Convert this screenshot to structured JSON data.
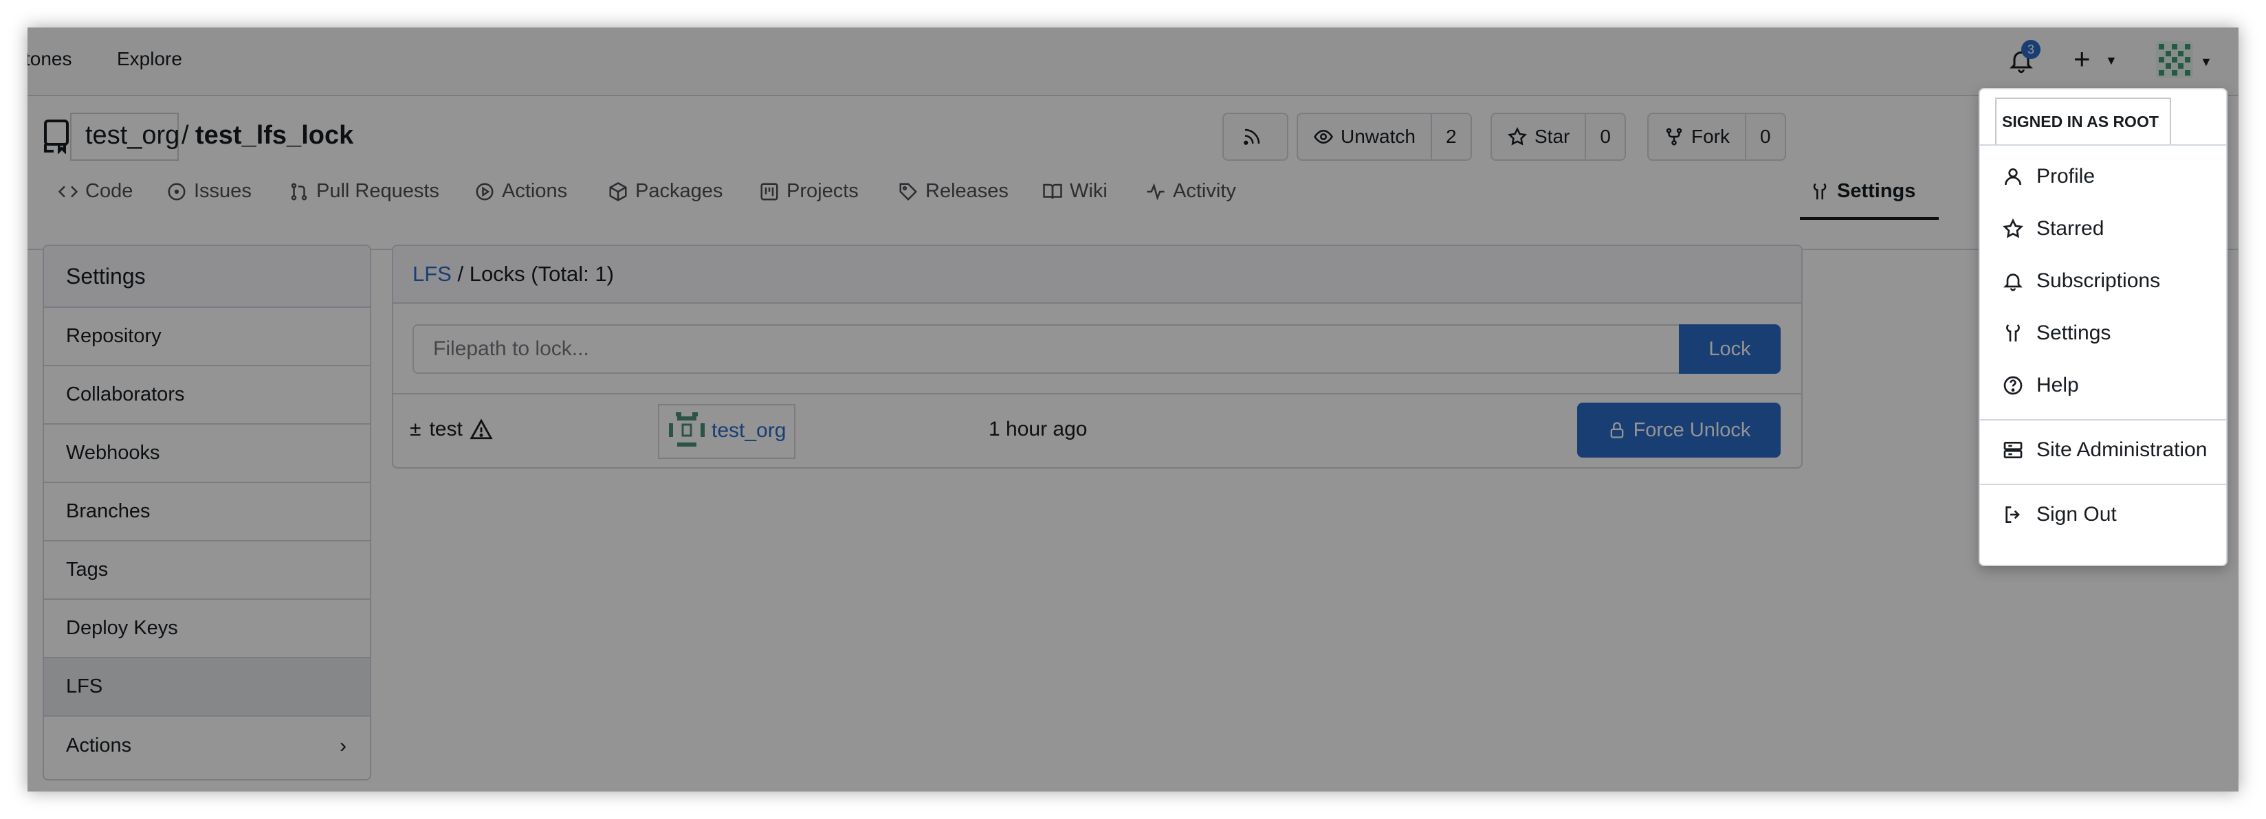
{
  "topnav": {
    "links": [
      "tones",
      "Explore"
    ],
    "notification_count": "3"
  },
  "repo": {
    "owner": "test_org",
    "separator": "/",
    "name": "test_lfs_lock",
    "watch": {
      "label": "Unwatch",
      "count": "2"
    },
    "star": {
      "label": "Star",
      "count": "0"
    },
    "fork": {
      "label": "Fork",
      "count": "0"
    }
  },
  "tabs": [
    {
      "label": "Code",
      "icon": "code-icon"
    },
    {
      "label": "Issues",
      "icon": "issue-icon"
    },
    {
      "label": "Pull Requests",
      "icon": "pull-request-icon"
    },
    {
      "label": "Actions",
      "icon": "play-icon"
    },
    {
      "label": "Packages",
      "icon": "package-icon"
    },
    {
      "label": "Projects",
      "icon": "project-icon"
    },
    {
      "label": "Releases",
      "icon": "tag-icon"
    },
    {
      "label": "Wiki",
      "icon": "book-icon"
    },
    {
      "label": "Activity",
      "icon": "pulse-icon"
    },
    {
      "label": "Settings",
      "icon": "tools-icon",
      "active": true
    }
  ],
  "sidebar": {
    "title": "Settings",
    "items": [
      "Repository",
      "Collaborators",
      "Webhooks",
      "Branches",
      "Tags",
      "Deploy Keys",
      "LFS",
      "Actions"
    ],
    "active": "LFS"
  },
  "panel": {
    "breadcrumb_link": "LFS",
    "breadcrumb_rest": " / Locks (Total: 1)",
    "input_placeholder": "Filepath to lock...",
    "lock_button": "Lock",
    "locks": [
      {
        "file": "test",
        "file_prefix": "±",
        "owner": "test_org",
        "time": "1 hour ago",
        "action": "Force Unlock"
      }
    ]
  },
  "menu": {
    "signed_in": "SIGNED IN AS ROOT",
    "items": [
      "Profile",
      "Starred",
      "Subscriptions",
      "Settings",
      "Help",
      "Site Administration",
      "Sign Out"
    ]
  },
  "colors": {
    "accent": "#2a6bc6",
    "border": "#d0d7de",
    "text": "#181c21"
  }
}
